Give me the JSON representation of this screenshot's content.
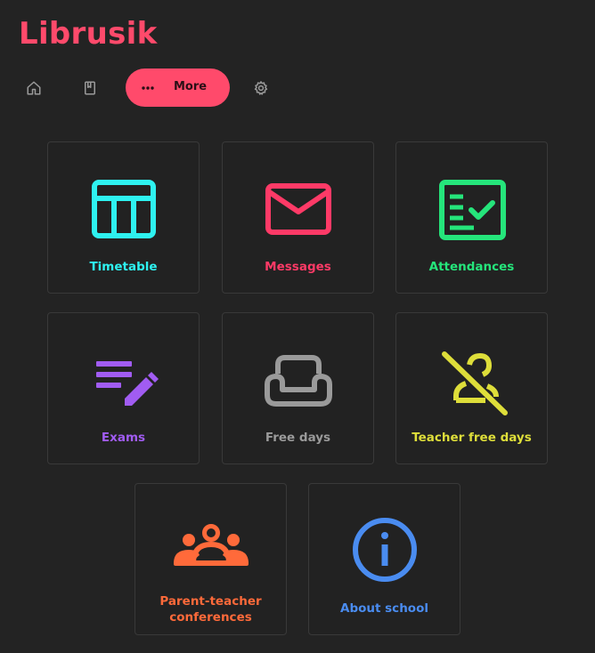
{
  "app": {
    "title": "Librusik"
  },
  "nav": {
    "home_icon": "home-icon",
    "book_icon": "book-icon",
    "more_label": "More",
    "settings_icon": "gear-icon",
    "accent": "#ff4a6b"
  },
  "tiles": {
    "timetable": {
      "label": "Timetable",
      "color": "#2ef2f0",
      "icon": "table-icon"
    },
    "messages": {
      "label": "Messages",
      "color": "#ff3a67",
      "icon": "envelope-icon"
    },
    "attendances": {
      "label": "Attendances",
      "color": "#25e57b",
      "icon": "checklist-icon"
    },
    "exams": {
      "label": "Exams",
      "color": "#a15cf2",
      "icon": "edit-note-icon"
    },
    "free_days": {
      "label": "Free days",
      "color": "#9a9a9a",
      "icon": "couch-icon"
    },
    "teacher_free_days": {
      "label": "Teacher free days",
      "color": "#dede3a",
      "icon": "person-off-icon"
    },
    "conferences": {
      "label": "Parent-teacher conferences",
      "color": "#ff6a3a",
      "icon": "groups-icon"
    },
    "about_school": {
      "label": "About school",
      "color": "#4a8cf0",
      "icon": "info-icon"
    }
  }
}
